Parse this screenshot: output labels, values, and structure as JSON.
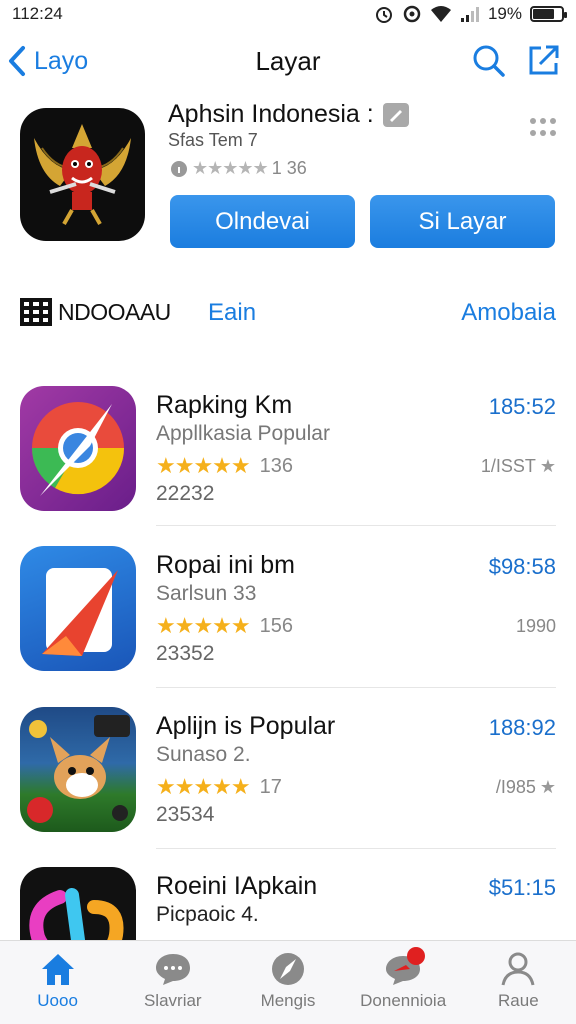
{
  "status_bar": {
    "time": "112:24",
    "battery": "19%",
    "battery_level": 0.75
  },
  "nav": {
    "back_label": "Layo",
    "title": "Layar"
  },
  "hero": {
    "title": "Aphsin Indonesia :",
    "subtitle": "Sfas Tem     7",
    "rating_count": "1 36",
    "button_primary": "Olndevai",
    "button_secondary": "Si Layar"
  },
  "section": {
    "title": "NDOOAAU",
    "link_left": "Eain",
    "link_right": "Amobaia"
  },
  "apps": [
    {
      "title": "Rapking Km",
      "subtitle": "Appllkasia Popular",
      "stars": "★★★★★",
      "rating_count": "136",
      "number": "22232",
      "price": "185:52",
      "meta": "1/ISST",
      "icon": "chrome-like-icon"
    },
    {
      "title": "Ropai ini bm",
      "subtitle": "Sarlsun 33",
      "stars": "★★★★★",
      "rating_count": "156",
      "number": "23352",
      "price": "$98:58",
      "meta": "1990",
      "icon": "red-paper-icon"
    },
    {
      "title": "Aplijn is Popular",
      "subtitle": "Sunaso 2.",
      "stars": "★★★★★",
      "rating_count": "17",
      "number": "23534",
      "price": "188:92",
      "meta": "/I985",
      "icon": "fox-game-icon"
    },
    {
      "title": "Roeini IApkain",
      "subtitle": "Picpaoic 4.",
      "stars": "",
      "rating_count": "",
      "number": "",
      "price": "$51:15",
      "meta": "",
      "icon": "colorful-letters-icon"
    }
  ],
  "tabs": [
    {
      "label": "Uooo",
      "icon": "home-icon"
    },
    {
      "label": "Slavriar",
      "icon": "chat-icon"
    },
    {
      "label": "Mengis",
      "icon": "compass-icon"
    },
    {
      "label": "Donennioia",
      "icon": "message-icon"
    },
    {
      "label": "Raue",
      "icon": "person-icon"
    }
  ],
  "colors": {
    "accent": "#1a7de0",
    "star": "#f5b01b",
    "badge": "#e02020"
  }
}
